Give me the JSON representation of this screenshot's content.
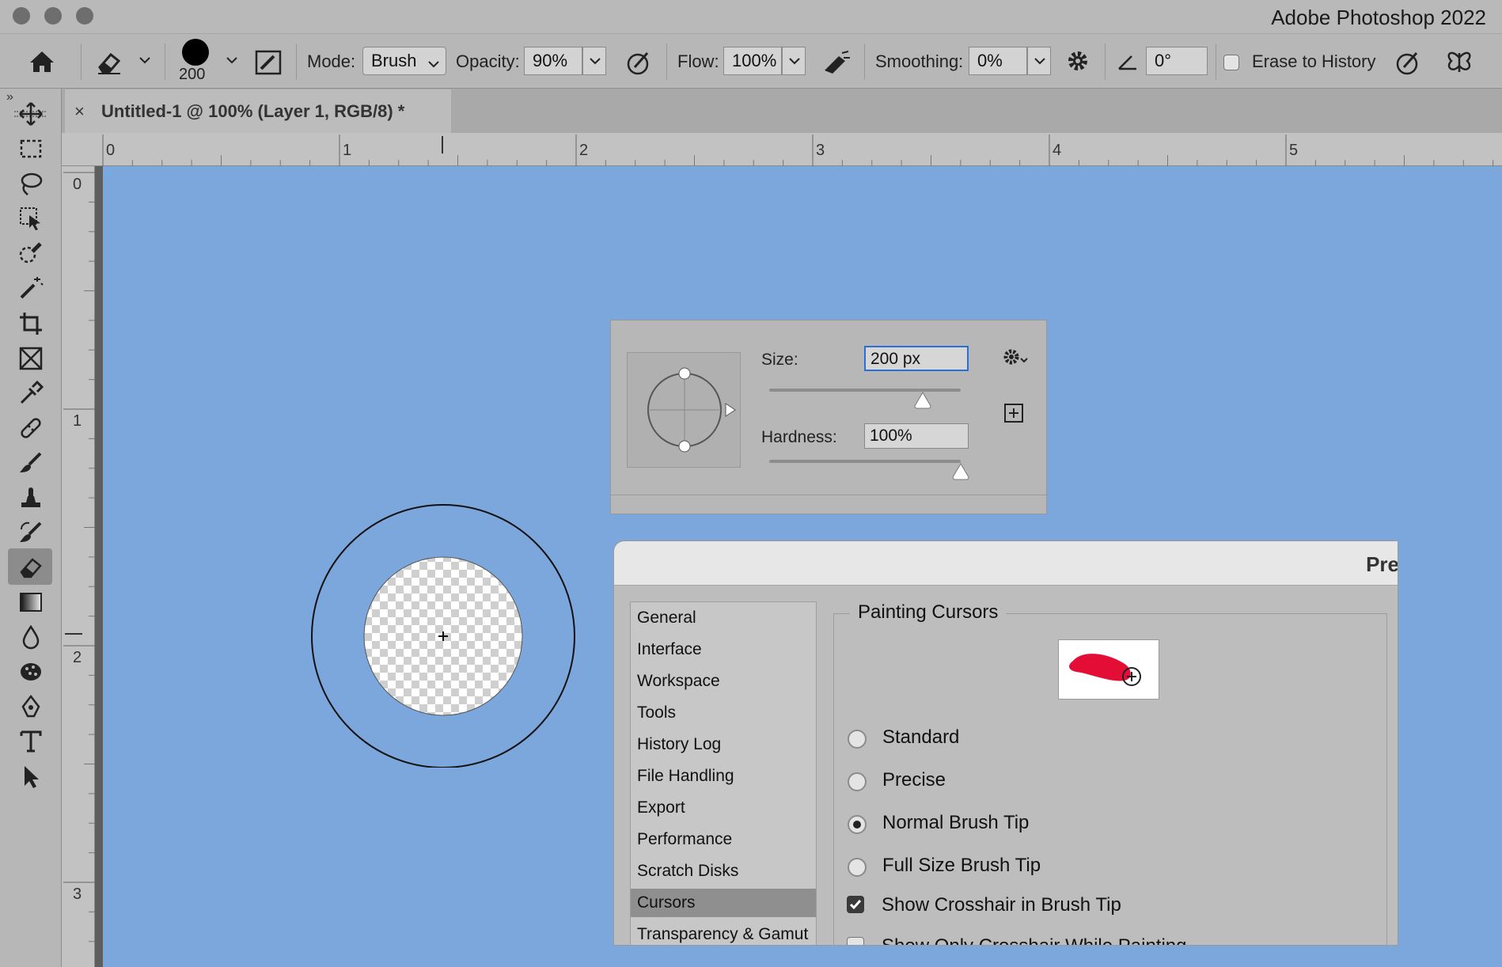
{
  "window": {
    "title": "Adobe Photoshop 2022"
  },
  "options_bar": {
    "brush_size": "200",
    "mode_label": "Mode:",
    "mode_value": "Brush",
    "opacity_label": "Opacity:",
    "opacity_value": "90%",
    "flow_label": "Flow:",
    "flow_value": "100%",
    "smoothing_label": "Smoothing:",
    "smoothing_value": "0%",
    "angle_value": "0°",
    "erase_to_history_label": "Erase to History",
    "erase_to_history_checked": false
  },
  "tools": [
    "move-tool-icon",
    "marquee-tool-icon",
    "lasso-tool-icon",
    "object-selection-tool-icon",
    "quick-selection-tool-icon",
    "magic-wand-tool-icon",
    "crop-tool-icon",
    "frame-tool-icon",
    "eyedropper-tool-icon",
    "healing-brush-tool-icon",
    "brush-tool-icon",
    "clone-stamp-tool-icon",
    "history-brush-tool-icon",
    "eraser-tool-icon",
    "gradient-tool-icon",
    "blur-tool-icon",
    "sponge-tool-icon",
    "pen-tool-icon",
    "type-tool-icon",
    "path-selection-tool-icon"
  ],
  "active_tool": "eraser-tool-icon",
  "document_tab": {
    "close": "×",
    "title": "Untitled-1 @ 100% (Layer 1, RGB/8) *"
  },
  "ruler": {
    "top_labels": [
      "0",
      "1",
      "2",
      "3",
      "4",
      "5"
    ],
    "left_labels": [
      "0",
      "1",
      "2",
      "3"
    ]
  },
  "brush_panel": {
    "size_label": "Size:",
    "size_value": "200 px",
    "size_fraction": 0.8,
    "hardness_label": "Hardness:",
    "hardness_value": "100%",
    "hardness_fraction": 1.0
  },
  "preferences": {
    "title": "Pre",
    "nav_items": [
      "General",
      "Interface",
      "Workspace",
      "Tools",
      "History Log",
      "File Handling",
      "Export",
      "Performance",
      "Scratch Disks",
      "Cursors",
      "Transparency & Gamut"
    ],
    "selected_nav": "Cursors",
    "painting_cursors": {
      "heading": "Painting Cursors",
      "options": [
        "Standard",
        "Precise",
        "Normal Brush Tip",
        "Full Size Brush Tip"
      ],
      "selected": "Normal Brush Tip",
      "crosshair_label": "Show Crosshair in Brush Tip",
      "crosshair_checked": true,
      "only_crosshair_label": "Show Only Crosshair While Painting"
    }
  },
  "colors": {
    "canvas": "#7ba7dc",
    "ui_gray": "#b7b7b7",
    "accent_blue": "#2a6fd6",
    "brush_stroke": "#e3002b"
  }
}
